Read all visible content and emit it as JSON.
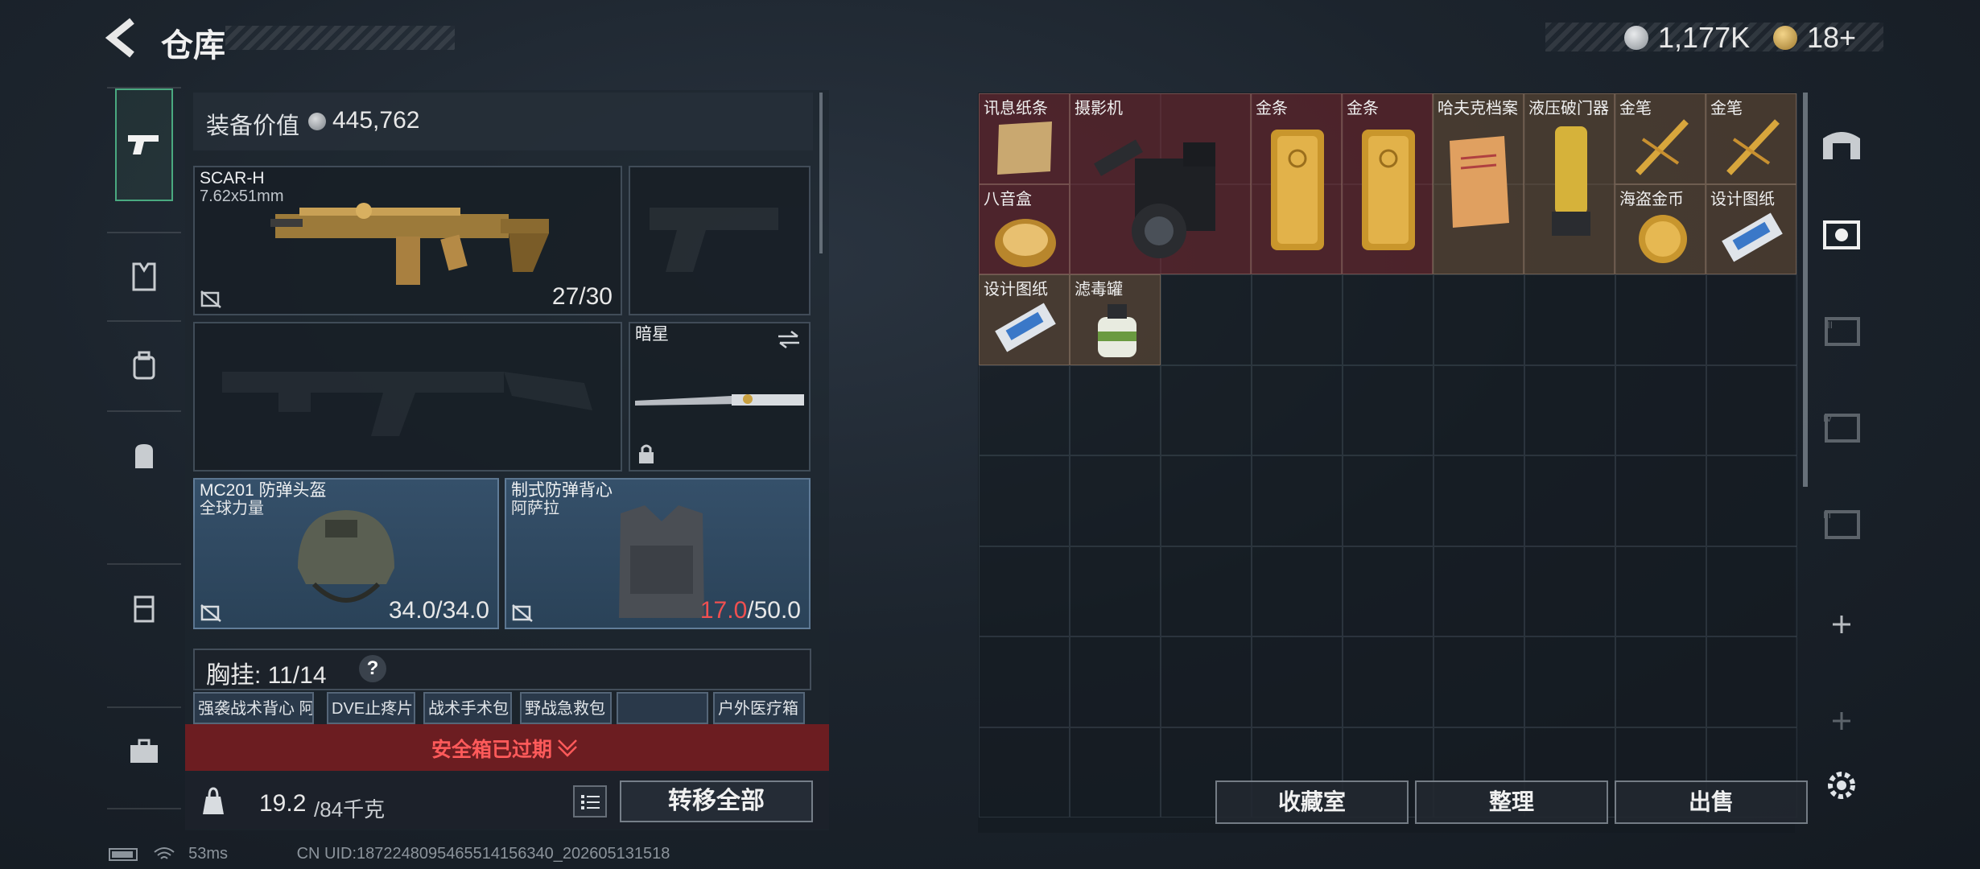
{
  "header": {
    "title": "仓库",
    "silver_amount": "1,177K",
    "gold_amount": "18+"
  },
  "rail": {
    "items": [
      {
        "icon": "pistol-icon",
        "active": true
      },
      {
        "icon": "armor-vest-icon"
      },
      {
        "icon": "backpack-small-icon"
      },
      {
        "icon": "backpack-icon"
      },
      {
        "icon": "container-icon"
      },
      {
        "icon": "briefcase-icon"
      }
    ]
  },
  "loadout": {
    "value_label": "装备价值",
    "value_amount": "445,762",
    "primary": {
      "name": "SCAR-H",
      "caliber": "7.62x51mm",
      "ammo": "27/30"
    },
    "melee": {
      "name": "暗星"
    },
    "helmet": {
      "name": "MC201 防弹头盔",
      "brand": "全球力量",
      "durability": "34.0/34.0"
    },
    "armor": {
      "name": "制式防弹背心",
      "brand": "阿萨拉",
      "durability_current": "17.0",
      "durability_max": "/50.0"
    },
    "chest_label": "胸挂: 11/14",
    "chest_help": "?",
    "chest_items": [
      "强袭战术背心 阿萨拉",
      "DVE止疼片",
      "战术手术包",
      "野战急救包",
      "",
      "户外医疗箱"
    ],
    "safebox_text": "安全箱已过期",
    "weight_value": "19.2",
    "weight_cap": "/84千克",
    "transfer_all": "转移全部"
  },
  "stash": {
    "items": [
      {
        "name": "讯息纸条",
        "color": "red"
      },
      {
        "name": "摄影机",
        "color": "red"
      },
      {
        "name": "金条",
        "color": "red"
      },
      {
        "name": "金条",
        "color": "red"
      },
      {
        "name": "哈夫克档案",
        "color": "brown"
      },
      {
        "name": "液压破门器",
        "color": "brown"
      },
      {
        "name": "金笔",
        "color": "brown"
      },
      {
        "name": "金笔",
        "color": "brown"
      },
      {
        "name": "八音盒",
        "color": "red"
      },
      {
        "name": "海盗金币",
        "color": "brown"
      },
      {
        "name": "设计图纸",
        "color": "brown"
      },
      {
        "name": "设计图纸",
        "color": "brown"
      },
      {
        "name": "滤毒罐",
        "color": "brown"
      }
    ],
    "buttons": {
      "collection": "收藏室",
      "organize": "整理",
      "sell": "出售"
    }
  },
  "status_bar": {
    "ping": "53ms",
    "uid": "CN UID:1872248095465514156340_202605131518"
  },
  "colors": {
    "accent_green": "#4aa980",
    "rare_red": "#7a2830",
    "rare_brown": "#6e523a",
    "warning_red": "#f05050"
  }
}
